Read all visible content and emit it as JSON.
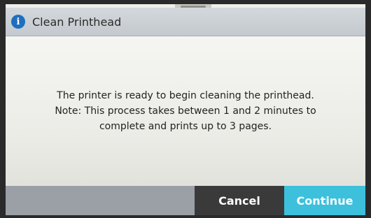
{
  "dialog": {
    "title": "Clean Printhead",
    "icon": "info-icon",
    "icon_glyph": "i",
    "message_lines": [
      "The printer is ready to begin cleaning the printhead.",
      "Note: This process takes between 1 and 2 minutes to",
      "complete and prints up to 3 pages."
    ]
  },
  "buttons": {
    "cancel_label": "Cancel",
    "continue_label": "Continue"
  },
  "colors": {
    "accent": "#3cc0dc",
    "info_icon": "#1e6fbf",
    "cancel_bg": "#3a3a3a"
  }
}
